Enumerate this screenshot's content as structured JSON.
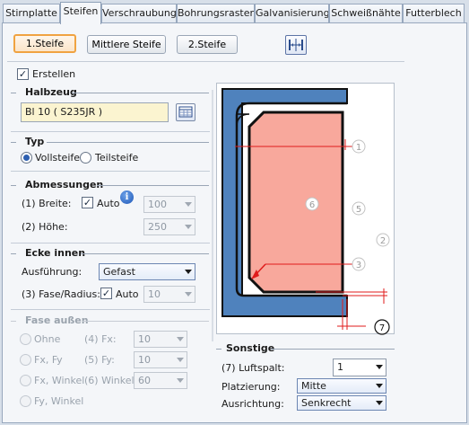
{
  "tabs": [
    {
      "label": "Stirnplatte",
      "active": false
    },
    {
      "label": "Steifen",
      "active": true
    },
    {
      "label": "Verschraubung",
      "active": false
    },
    {
      "label": "Bohrungsraster",
      "active": false
    },
    {
      "label": "Galvanisierung",
      "active": false
    },
    {
      "label": "Schweißnähte",
      "active": false
    },
    {
      "label": "Futterblech",
      "active": false
    }
  ],
  "stiffener_buttons": {
    "first": "1.Steife",
    "middle": "Mittlere Steife",
    "second": "2.Steife"
  },
  "erstellen": {
    "label": "Erstellen",
    "checked": true
  },
  "halbzeug": {
    "title": "Halbzeug",
    "value": "Bl 10  ( S235JR )"
  },
  "typ": {
    "title": "Typ",
    "options": [
      "Vollsteife",
      "Teilsteife"
    ],
    "selected": "Vollsteife"
  },
  "abmessungen": {
    "title": "Abmessungen",
    "breite_label": "(1) Breite:",
    "auto_label": "Auto",
    "auto_checked": true,
    "breite_value": "100",
    "hoehe_label": "(2) Höhe:",
    "hoehe_value": "250"
  },
  "ecke_innen": {
    "title": "Ecke innen",
    "ausfuehrung_label": "Ausführung:",
    "ausfuehrung_value": "Gefast",
    "fase_label": "(3) Fase/Radius:",
    "auto_label": "Auto",
    "auto_checked": true,
    "fase_value": "10"
  },
  "fase_aussen": {
    "title": "Fase außen",
    "options": [
      "Ohne",
      "Fx, Fy",
      "Fx, Winkel",
      "Fy, Winkel"
    ],
    "fx_label": "(4) Fx:",
    "fx_value": "10",
    "fy_label": "(5) Fy:",
    "fy_value": "10",
    "winkel_label": "(6) Winkel:",
    "winkel_value": "60"
  },
  "sonstige": {
    "title": "Sonstige",
    "luftspalt_label": "(7) Luftspalt:",
    "luftspalt_value": "1",
    "platzierung_label": "Platzierung:",
    "platzierung_value": "Mitte",
    "ausrichtung_label": "Ausrichtung:",
    "ausrichtung_value": "Senkrecht"
  },
  "diagram": {
    "labels": [
      "1",
      "2",
      "3",
      "5",
      "6",
      "7"
    ]
  },
  "colors": {
    "accent": "#f0a341",
    "profile": "#4f82bd",
    "stiffener": "#f8a89c",
    "dim": "#e01b1b"
  }
}
